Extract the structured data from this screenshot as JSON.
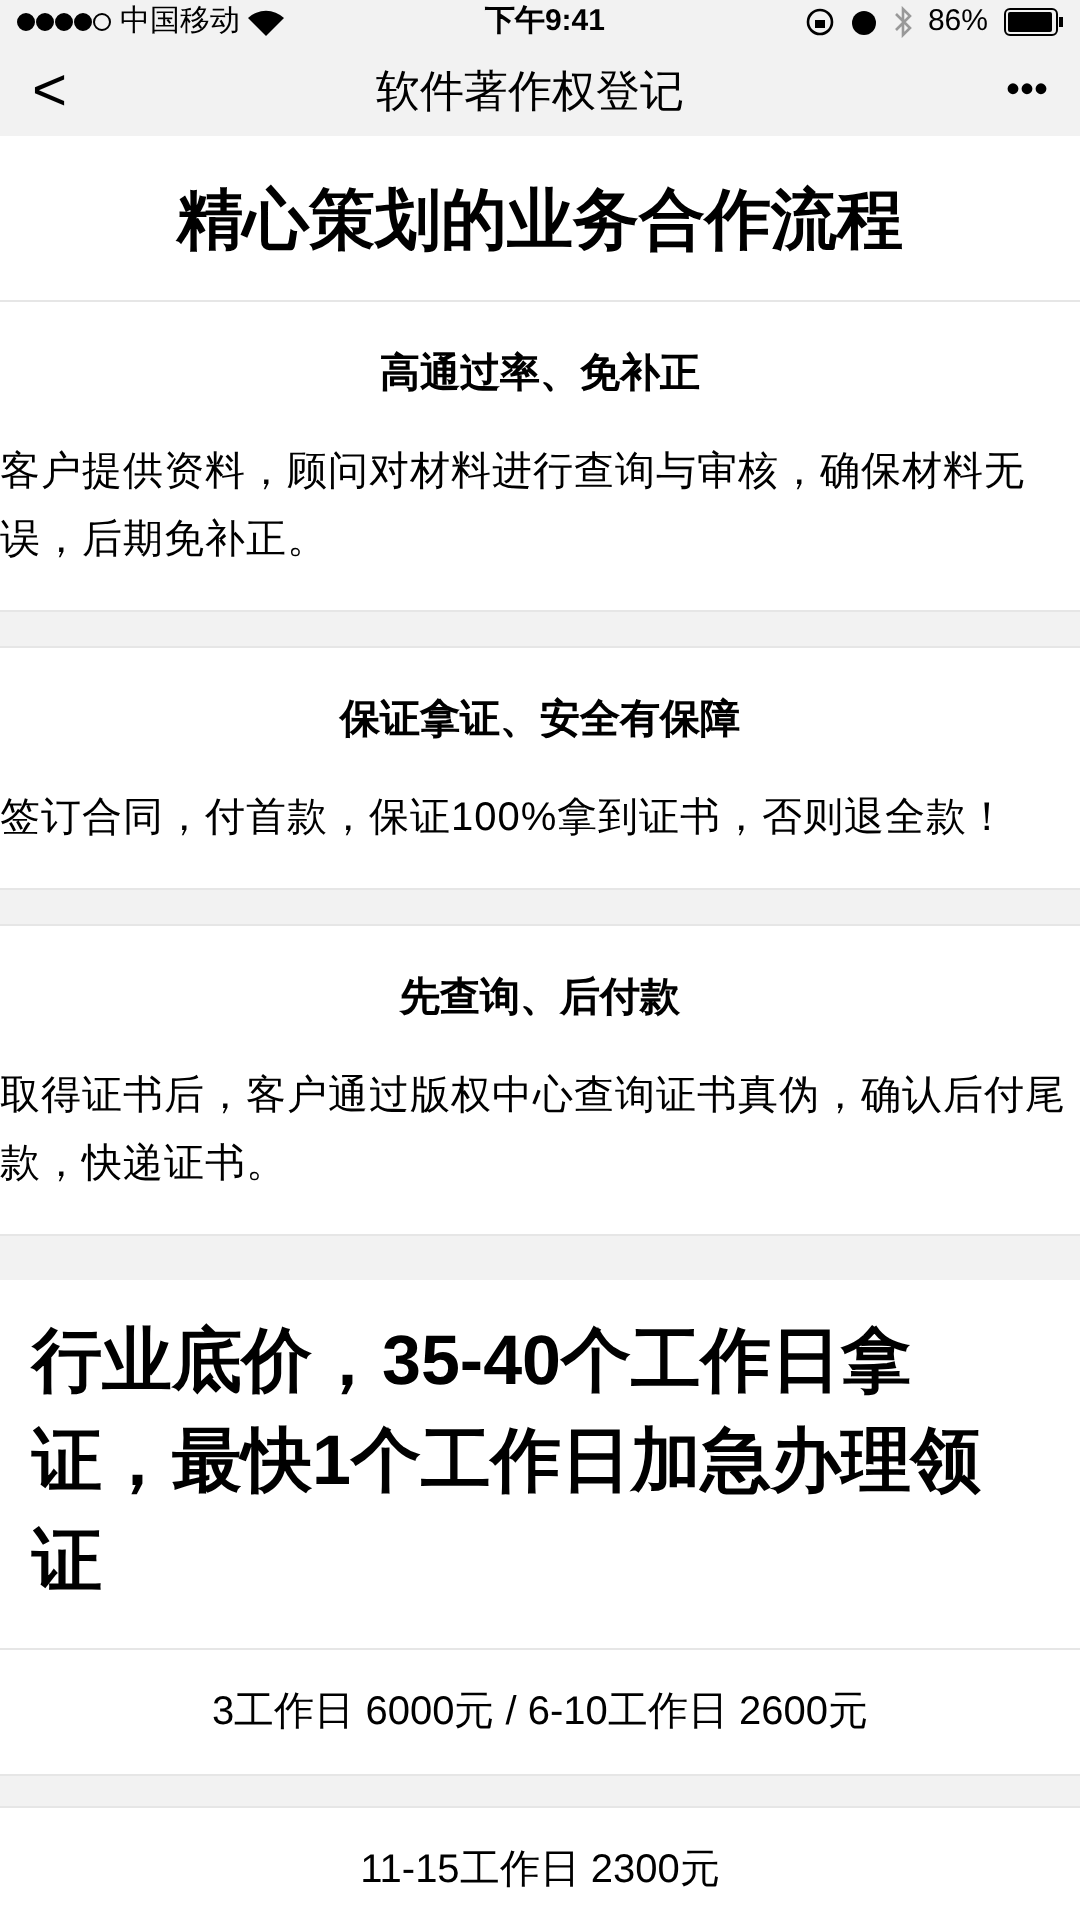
{
  "status_bar": {
    "carrier": "中国移动",
    "time": "下午9:41",
    "battery": "86%"
  },
  "nav": {
    "back": "<",
    "title": "软件著作权登记",
    "more": "•••"
  },
  "section_title": "精心策划的业务合作流程",
  "cards": [
    {
      "title": "高通过率、免补正",
      "body": "客户提供资料，顾问对材料进行查询与审核，确保材料无误，后期免补正。"
    },
    {
      "title": "保证拿证、安全有保障",
      "body": "签订合同，付首款，保证100%拿到证书，否则退全款！"
    },
    {
      "title": "先查询、后付款",
      "body": "取得证书后，客户通过版权中心查询证书真伪，确认后付尾款，快递证书。"
    }
  ],
  "price_title": "行业底价，35-40个工作日拿证，最快1个工作日加急办理领证",
  "prices": [
    "3工作日 6000元 / 6-10工作日 2600元",
    "11-15工作日 2300元"
  ]
}
